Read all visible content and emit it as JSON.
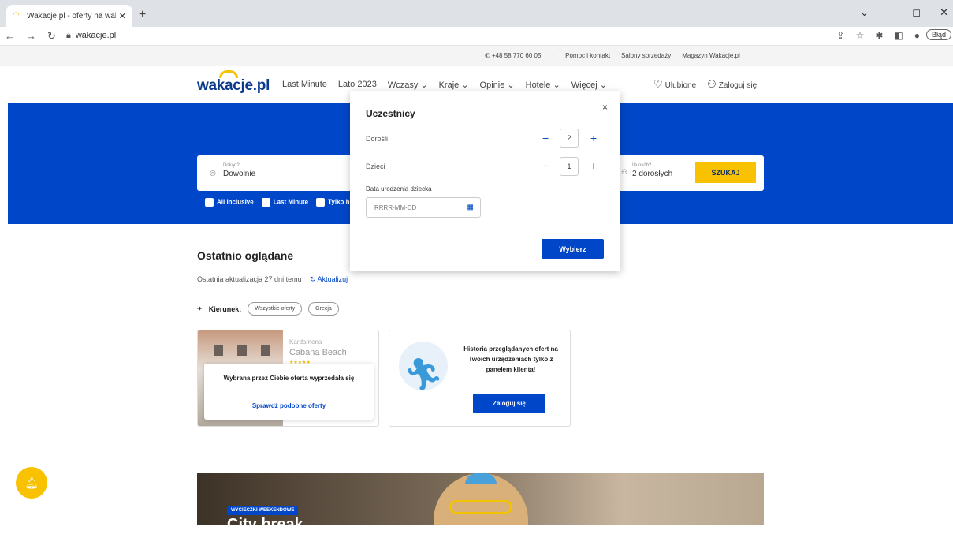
{
  "browser": {
    "tab_title": "Wakacje.pl - oferty na wakacje i",
    "tab_close": "✕",
    "new_tab": "+",
    "url": "wakacje.pl",
    "error_label": "Błąd",
    "window_controls": [
      "⌄",
      "–",
      "◻",
      "✕"
    ]
  },
  "topbar": {
    "phone": "+48 58 770 60 05",
    "links": [
      "Pomoc i kontakt",
      "Salony sprzedaży",
      "Magazyn Wakacje.pl"
    ]
  },
  "header": {
    "logo": "wakacje.pl",
    "nav": [
      "Last Minute",
      "Lato 2023",
      "Wczasy ⌄",
      "Kraje ⌄",
      "Opinie ⌄",
      "Hotele ⌄",
      "Więcej ⌄"
    ],
    "favorites": "Ulubione",
    "login": "Zaloguj się"
  },
  "search": {
    "dokad_label": "Dokąd?",
    "dokad_value": "Dowolnie",
    "ile_label": "Ile osób?",
    "ile_value": "2 dorosłych",
    "submit": "SZUKAJ",
    "filters": [
      "All Inclusive",
      "Last Minute",
      "Tylko h"
    ]
  },
  "modal": {
    "title": "Uczestnicy",
    "close": "×",
    "adults_label": "Dorośli",
    "adults_value": "2",
    "children_label": "Dzieci",
    "children_value": "1",
    "minus": "−",
    "plus": "+",
    "dob_label": "Data urodzenia dziecka",
    "dob_placeholder": "RRRR-MM-DD",
    "submit": "Wybierz"
  },
  "recent": {
    "title": "Ostatnio oglądane",
    "updated": "Ostatnia aktualizacja 27 dni temu",
    "refresh": "Aktualizuj",
    "direction_label": "Kierunek:",
    "pills": [
      "Wszystkie oferty",
      "Grecja"
    ],
    "card1": {
      "location": "Kardamena",
      "hotel": "Cabana Beach",
      "stars": "★★★★★",
      "soldout_text": "Wybrana przez Ciebie oferta wyprzedała się",
      "similar_link": "Sprawdź podobne oferty"
    },
    "card2": {
      "text": "Historia przeglądanych ofert na Twoich urządzeniach tylko z panelem klienta!",
      "button": "Zaloguj się"
    }
  },
  "banner": {
    "badge": "WYCIECZKI WEEKENDOWE",
    "title": "City break"
  }
}
